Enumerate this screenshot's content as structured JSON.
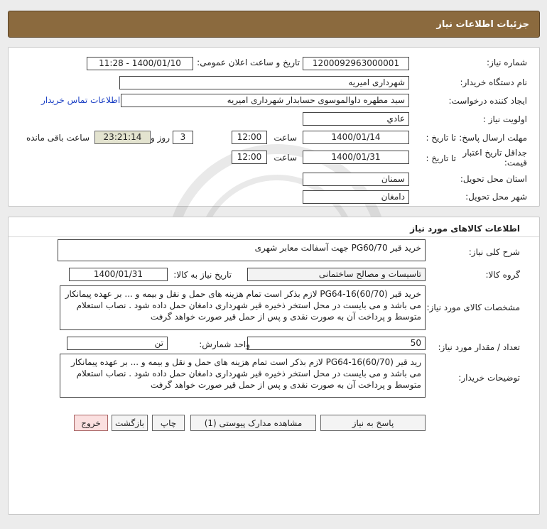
{
  "header": {
    "title": "جزئیات اطلاعات نیاز"
  },
  "need": {
    "number_label": "شماره نیاز:",
    "number": "1200092963000001",
    "announce_label": "تاریخ و ساعت اعلان عمومی:",
    "announce": "1400/01/10 - 11:28",
    "buyer_label": "نام دستگاه خریدار:",
    "buyer": "شهرداری امیریه",
    "creator_label": "ایجاد کننده درخواست:",
    "creator": "سید مطهره  داوالموسوی حسابدار شهرداری امیریه",
    "contact_link": "اطلاعات تماس خریدار",
    "priority_label": "اولویت نیاز :",
    "priority": "عادي",
    "deadline_label": "مهلت ارسال پاسخ:",
    "to_date_label": "تا تاریخ :",
    "deadline_date": "1400/01/14",
    "time_label": "ساعت",
    "deadline_time": "12:00",
    "days": "3",
    "days_label": "روز و",
    "remaining": "23:21:14",
    "remaining_label": "ساعت باقی مانده",
    "validity_label_1": "جداقل تاریخ اعتبار",
    "validity_label_2": "قیمت:",
    "validity_date": "1400/01/31",
    "validity_time": "12:00",
    "province_label": "استان محل تحویل:",
    "province": "سمنان",
    "city_label": "شهر محل تحویل:",
    "city": "دامغان"
  },
  "goods": {
    "section_title": "اطلاعات کالاهای مورد نیاز",
    "desc_label": "شرح کلی نیاز:",
    "desc": "خرید قیر PG60/70  جهت آسفالت معابر شهری",
    "group_label": "گروه کالا:",
    "group": "تاسیسات و مصالح ساختمانی",
    "need_date_label": "تاریخ نیاز به کالا:",
    "need_date": "1400/01/31",
    "spec_label": "مشخصات کالای مورد نیاز:",
    "spec": "خرید قیر (PG64-16(60/70  لازم بذکر است تمام هزینه های حمل و نقل و بیمه و ... بر عهده  پیمانکار می باشد و می بایست در محل استخر ذخیره قیر شهرداری دامغان حمل  داده شود . نصاب استعلام متوسط و پرداخت آن به صورت نقدی و پس از حمل قیر صورت خواهد گرفت",
    "qty_label": "تعداد / مقدار مورد نیاز:",
    "qty": "50",
    "unit_label": "واحد شمارش:",
    "unit": "تن",
    "buyer_notes_label": "توضیحات خریدار:",
    "buyer_notes": "رید قیر (PG64-16(60/70  لازم بذکر است تمام هزینه های حمل و نقل و بیمه و ... بر عهده  پیمانکار می باشد و می بایست در محل استخر ذخیره قیر شهرداری دامغان حمل  داده شود . نصاب استعلام متوسط و پرداخت آن به صورت نقدی و پس از حمل قیر صورت خواهد گرفت"
  },
  "buttons": {
    "reply": "پاسخ به نیاز",
    "attachments": "مشاهده مدارک پیوستی (1)",
    "print": "چاپ",
    "back": "بازگشت",
    "exit": "خروج"
  }
}
